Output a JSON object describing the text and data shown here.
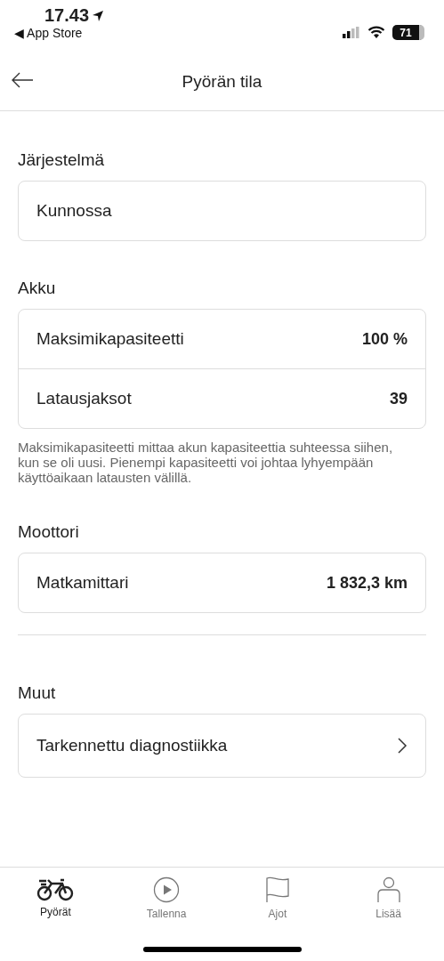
{
  "status_bar": {
    "time": "17.43",
    "back_link": "◀ App Store",
    "battery": "71"
  },
  "header": {
    "title": "Pyörän tila"
  },
  "sections": [
    {
      "kind": "section",
      "title": "Järjestelmä",
      "rows": [
        {
          "kind": "text",
          "label": "Kunnossa"
        }
      ]
    },
    {
      "kind": "section",
      "title": "Akku",
      "rows": [
        {
          "kind": "value",
          "label": "Maksimikapasiteetti",
          "value": "100 %"
        },
        {
          "kind": "value",
          "label": "Latausjaksot",
          "value": "39"
        }
      ],
      "note": "Maksimikapasiteetti mittaa akun kapasiteettia suhteessa siihen, kun se oli uusi. Pienempi kapasiteetti voi johtaa lyhyempään käyttöaikaan latausten välillä."
    },
    {
      "kind": "section",
      "title": "Moottori",
      "rows": [
        {
          "kind": "value",
          "label": "Matkamittari",
          "value": "1 832,3 km"
        }
      ]
    },
    {
      "kind": "divider"
    },
    {
      "kind": "section",
      "title": "Muut",
      "rows": [
        {
          "kind": "link",
          "label": "Tarkennettu diagnostiikka"
        }
      ]
    }
  ],
  "tabs": [
    {
      "kind": "bike",
      "label": "Pyörät",
      "selected": true
    },
    {
      "kind": "play",
      "label": "Tallenna",
      "selected": false
    },
    {
      "kind": "flag",
      "label": "Ajot",
      "selected": false
    },
    {
      "kind": "person",
      "label": "Lisää",
      "selected": false
    }
  ]
}
